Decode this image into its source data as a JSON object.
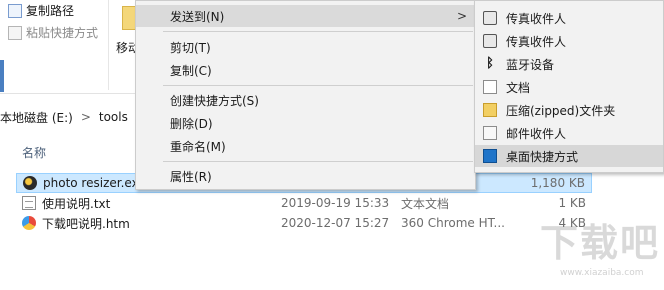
{
  "ribbon": {
    "copy_path": "复制路径",
    "paste_shortcut": "粘贴快捷方式",
    "move_to": "移动"
  },
  "address": {
    "drive": "本地磁盘 (E:)",
    "folder": "tools",
    "separator": ">"
  },
  "filelist": {
    "col_name": "名称",
    "files": [
      {
        "name": "photo resizer.exe",
        "date": "",
        "type": "",
        "size": "1,180 KB"
      },
      {
        "name": "使用说明.txt",
        "date": "2019-09-19 15:33",
        "type": "文本文档",
        "size": "1 KB"
      },
      {
        "name": "下载吧说明.htm",
        "date": "2020-12-07 15:27",
        "type": "360 Chrome HT...",
        "size": "4 KB"
      }
    ]
  },
  "context_menu": {
    "send_to": "发送到(N)",
    "submenu_arrow": ">",
    "cut": "剪切(T)",
    "copy": "复制(C)",
    "create_shortcut": "创建快捷方式(S)",
    "delete": "删除(D)",
    "rename": "重命名(M)",
    "properties": "属性(R)"
  },
  "send_to_menu": {
    "items": [
      {
        "label": "传真收件人",
        "icon": "fax-icon"
      },
      {
        "label": "传真收件人",
        "icon": "fax-icon"
      },
      {
        "label": "蓝牙设备",
        "icon": "bluetooth-icon"
      },
      {
        "label": "文档",
        "icon": "document-icon"
      },
      {
        "label": "压缩(zipped)文件夹",
        "icon": "zip-folder-icon"
      },
      {
        "label": "邮件收件人",
        "icon": "mail-icon"
      },
      {
        "label": "桌面快捷方式",
        "icon": "desktop-icon"
      }
    ]
  },
  "watermark": {
    "text": "下载吧",
    "url": "www.xiazaiba.com"
  }
}
